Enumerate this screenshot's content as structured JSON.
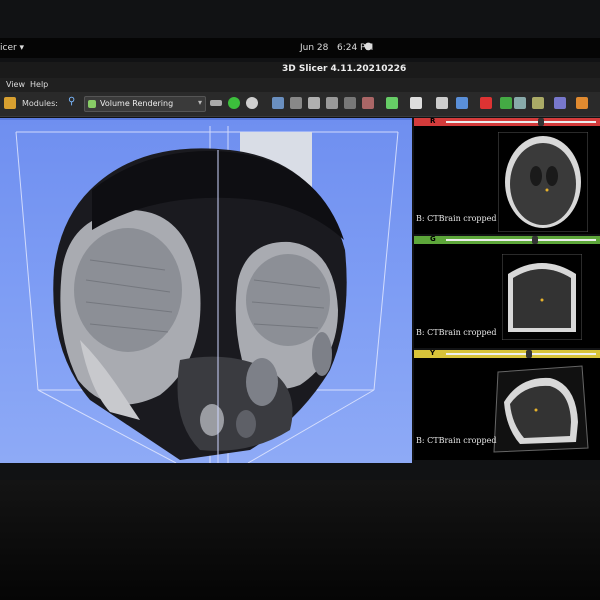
{
  "topbar": {
    "app_menu": "icer ▾",
    "date": "Jun 28",
    "time": "6:24 PM"
  },
  "window": {
    "title": "3D Slicer 4.11.20210226"
  },
  "menubar": {
    "items": [
      "View",
      "Help"
    ]
  },
  "toolbar": {
    "modules_label": "Modules:",
    "module_selected": "Volume Rendering"
  },
  "slice_views": [
    {
      "tag": "R",
      "color": "#d33b3b",
      "label": "B: CTBrain cropped"
    },
    {
      "tag": "G",
      "color": "#5da63a",
      "label": "B: CTBrain cropped"
    },
    {
      "tag": "Y",
      "color": "#d8c33a",
      "label": "B: CTBrain cropped"
    }
  ],
  "colors": {
    "view_bg": "#7e9df4",
    "accent_blue": "#5a7be0"
  }
}
